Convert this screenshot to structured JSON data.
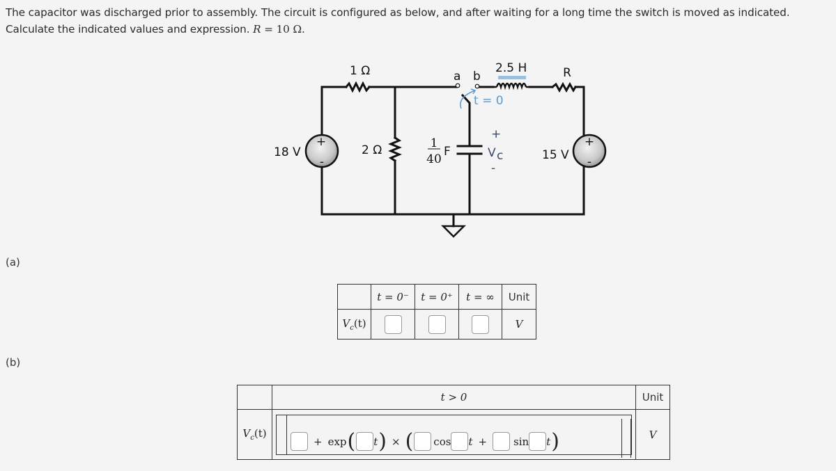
{
  "prompt": {
    "text": "The capacitor was discharged prior to assembly. The circuit is configured as below, and after waiting for a long time the switch is moved as indicated. Calculate the indicated values and expression.",
    "given_var": "R",
    "given_eq": " = 10 ",
    "given_unit": "Ω",
    "given_end": "."
  },
  "circuit": {
    "source_left": {
      "label": "18 V",
      "plus": "+",
      "minus": "-"
    },
    "source_right": {
      "label": "15 V",
      "plus": "+",
      "minus": "-"
    },
    "resistor_1": "1 Ω",
    "resistor_2": "2 Ω",
    "resistor_R": "R",
    "capacitor": {
      "num": "1",
      "den": "40",
      "unit": "F"
    },
    "inductor": "2.5 H",
    "switch": {
      "a": "a",
      "b": "b",
      "time": "t = 0"
    },
    "vc": {
      "label": "V",
      "sub": "c",
      "plus": "+",
      "minus": "-"
    },
    "accent_color": "#5b9bd5"
  },
  "parts": {
    "a": "(a)",
    "b": "(b)"
  },
  "table_a": {
    "headers": [
      "",
      "t = 0⁻",
      "t = 0⁺",
      "t = ∞",
      "Unit"
    ],
    "row_label": "V",
    "row_label_sub": "c",
    "row_label_arg": "(t)",
    "inputs": [
      {
        "name": "vc-t0-minus",
        "value": ""
      },
      {
        "name": "vc-t0-plus",
        "value": ""
      },
      {
        "name": "vc-t-inf",
        "value": ""
      }
    ],
    "unit": "V"
  },
  "table_b": {
    "header_condition": "t > 0",
    "header_unit": "Unit",
    "row_label": "V",
    "row_label_sub": "c",
    "row_label_arg": "(t)",
    "plus": "+",
    "exp": "exp",
    "t": "t",
    "times": "×",
    "cos": "cos",
    "sin": "sin",
    "unit": "V",
    "inputs": [
      {
        "name": "constant-term",
        "value": ""
      },
      {
        "name": "exp-coefficient",
        "value": ""
      },
      {
        "name": "cos-amplitude",
        "value": ""
      },
      {
        "name": "cos-frequency",
        "value": ""
      },
      {
        "name": "sin-amplitude",
        "value": ""
      },
      {
        "name": "sin-frequency",
        "value": ""
      }
    ]
  }
}
